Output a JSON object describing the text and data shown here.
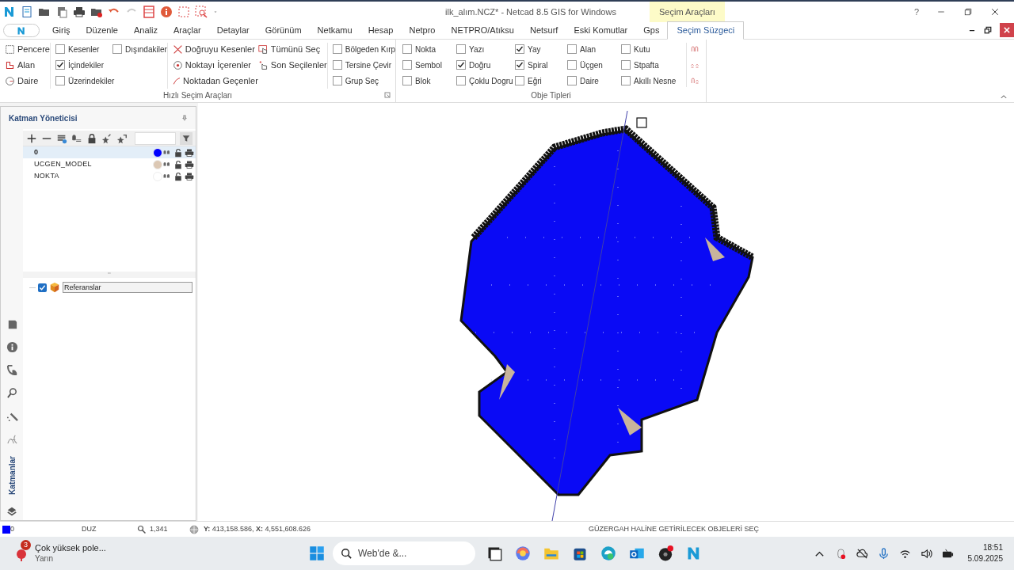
{
  "title_bar": {
    "title": "ilk_alım.NCZ* - Netcad 8.5 GIS for Windows",
    "context_tab": "Seçim Araçları",
    "help": "?"
  },
  "tabs": [
    {
      "label": "Giriş",
      "selected": false
    },
    {
      "label": "Düzenle",
      "selected": false
    },
    {
      "label": "Analiz",
      "selected": false
    },
    {
      "label": "Araçlar",
      "selected": false
    },
    {
      "label": "Detaylar",
      "selected": false
    },
    {
      "label": "Görünüm",
      "selected": false
    },
    {
      "label": "Netkamu",
      "selected": false
    },
    {
      "label": "Hesap",
      "selected": false
    },
    {
      "label": "Netpro",
      "selected": false
    },
    {
      "label": "NETPRO/Atıksu",
      "selected": false
    },
    {
      "label": "Netsurf",
      "selected": false
    },
    {
      "label": "Eski Komutlar",
      "selected": false
    },
    {
      "label": "Gps",
      "selected": false
    },
    {
      "label": "Seçim Süzgeci",
      "selected": true
    }
  ],
  "quick_selection": {
    "title": "Hızlı Seçim Araçları",
    "columns": [
      [
        {
          "kind": "tool",
          "label": "Pencere"
        },
        {
          "kind": "tool",
          "label": "Alan"
        },
        {
          "kind": "tool",
          "label": "Daire"
        }
      ],
      [
        {
          "kind": "check",
          "label": "Kesenler",
          "checked": false
        },
        {
          "kind": "check",
          "label": "İçindekiler",
          "checked": true
        },
        {
          "kind": "check",
          "label": "Üzerindekiler",
          "checked": false
        }
      ],
      [
        {
          "kind": "check",
          "label": "Dışındakiler",
          "checked": false
        }
      ],
      [
        {
          "kind": "tool",
          "label": "Doğruyu Kesenler"
        },
        {
          "kind": "tool",
          "label": "Noktayı İçerenler"
        },
        {
          "kind": "tool",
          "label": "Noktadan Geçenler"
        }
      ],
      [
        {
          "kind": "tool",
          "label": "Tümünü Seç"
        },
        {
          "kind": "tool",
          "label": "Son Seçilenler"
        }
      ],
      [
        {
          "kind": "check",
          "label": "Bölgeden Kırp",
          "checked": false
        },
        {
          "kind": "check",
          "label": "Tersine Çevir",
          "checked": false
        },
        {
          "kind": "check",
          "label": "Grup Seç",
          "checked": false
        }
      ]
    ]
  },
  "object_types": {
    "title": "Obje Tipleri",
    "columns": [
      [
        {
          "label": "Nokta",
          "checked": false
        },
        {
          "label": "Sembol",
          "checked": false
        },
        {
          "label": "Blok",
          "checked": false
        }
      ],
      [
        {
          "label": "Yazı",
          "checked": false
        },
        {
          "label": "Doğru",
          "checked": true
        },
        {
          "label": "Çoklu Dogru",
          "checked": false
        }
      ],
      [
        {
          "label": "Yay",
          "checked": true
        },
        {
          "label": "Spiral",
          "checked": true
        },
        {
          "label": "Eğri",
          "checked": false
        }
      ],
      [
        {
          "label": "Alan",
          "checked": false
        },
        {
          "label": "Üçgen",
          "checked": false
        },
        {
          "label": "Daire",
          "checked": false
        }
      ],
      [
        {
          "label": "Kutu",
          "checked": false
        },
        {
          "label": "Stpafta",
          "checked": false
        },
        {
          "label": "Akıllı Nesne",
          "checked": false
        }
      ]
    ]
  },
  "layer_panel": {
    "title": "Katman Yöneticisi",
    "layers": [
      {
        "name": "0",
        "color": "#0000ff",
        "selected": true
      },
      {
        "name": "UCGEN_MODEL",
        "color": "#dcc8b4",
        "selected": false
      },
      {
        "name": "NOKTA",
        "color": "#ffffff",
        "selected": false
      }
    ],
    "references": {
      "label": "Referanslar",
      "checked": true
    },
    "side_tab": "Katmanlar"
  },
  "status_bar": {
    "layer": "0",
    "mode": "DUZ",
    "zoom": "1,341",
    "coords": "**Y:** 413,158.586, **X:** 4,551,608.626",
    "message": "GÜZERGAH HALİNE GETİRİLECEK OBJELERİ SEÇ"
  },
  "taskbar": {
    "weather_badge": "3",
    "weather_title": "Çok yüksek pole...",
    "weather_sub": "Yarın",
    "search_placeholder": "Web'de &...",
    "time": "18:51",
    "date": "5.09.2025"
  }
}
